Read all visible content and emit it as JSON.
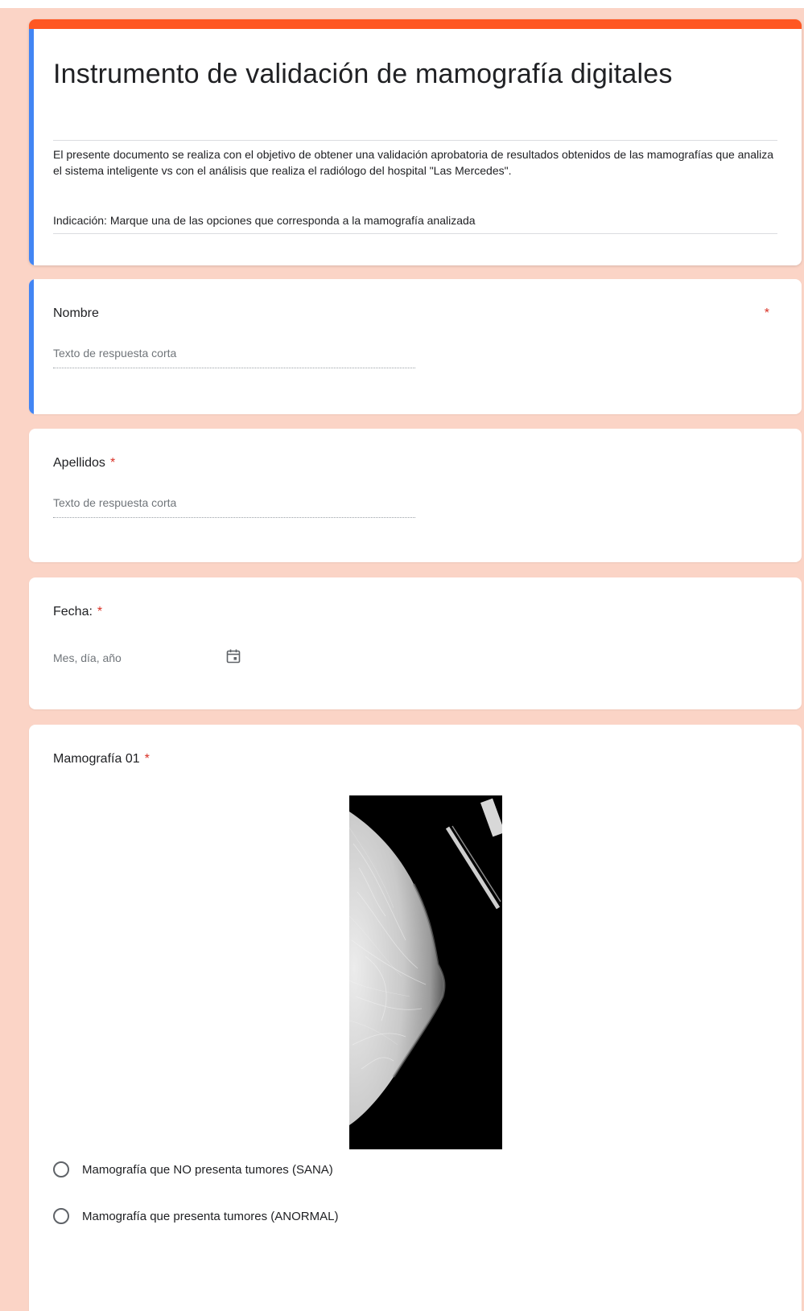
{
  "colors": {
    "page_background": "#fbd4c6",
    "header_stripe": "#ff5722",
    "accent_blue": "#4285f4",
    "required": "#d93025"
  },
  "header": {
    "title": "Instrumento de validación de mamografía digitales",
    "description": "El presente documento se realiza con el objetivo de obtener una validación aprobatoria de resultados obtenidos de las mamografías que analiza el sistema inteligente vs con el análisis que realiza el radiólogo del hospital \"Las Mercedes\".",
    "indication": "Indicación: Marque una de las opciones que corresponda a la mamografía analizada"
  },
  "questions": {
    "nombre": {
      "label": "Nombre",
      "required_mark": "*",
      "placeholder": "Texto de respuesta corta"
    },
    "apellidos": {
      "label": "Apellidos",
      "required_mark": "*",
      "placeholder": "Texto de respuesta corta"
    },
    "fecha": {
      "label": "Fecha:",
      "required_mark": "*",
      "placeholder": "Mes, día, año",
      "icon": "calendar-icon"
    },
    "mamografia": {
      "label": "Mamografía 01",
      "required_mark": "*",
      "options": [
        "Mamografía que NO presenta tumores (SANA)",
        "Mamografía que presenta tumores (ANORMAL)"
      ]
    }
  }
}
